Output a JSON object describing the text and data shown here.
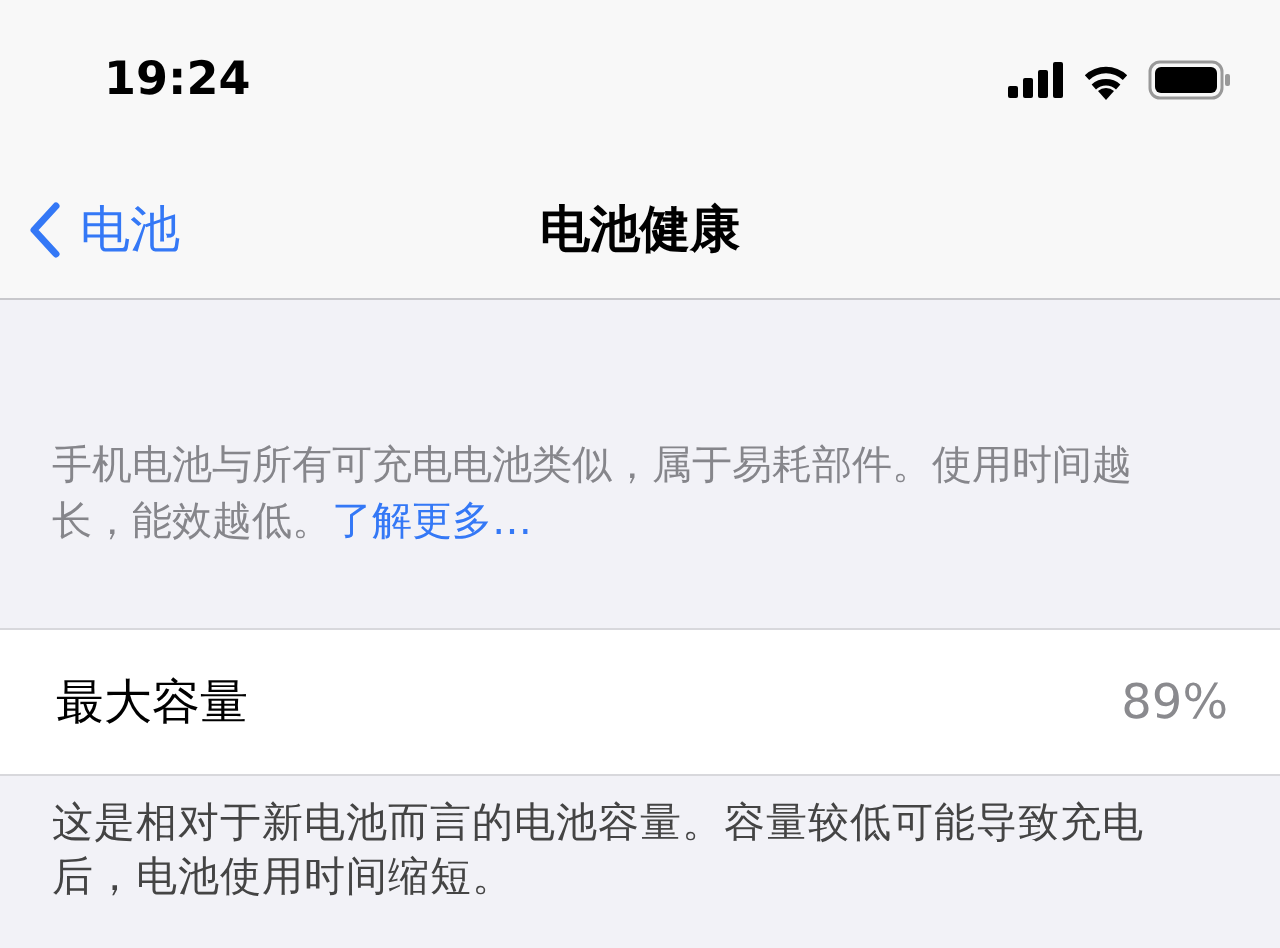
{
  "status_bar": {
    "time": "19:24"
  },
  "nav": {
    "back": "电池",
    "title": "电池健康"
  },
  "description": {
    "text": "手机电池与所有可充电电池类似，属于易耗部件。使用时间越长，能效越低。",
    "link": "了解更多…"
  },
  "capacity": {
    "label": "最大容量",
    "value": "89%"
  },
  "footer": "这是相对于新电池而言的电池容量。容量较低可能导致充电后，电池使用时间缩短。"
}
